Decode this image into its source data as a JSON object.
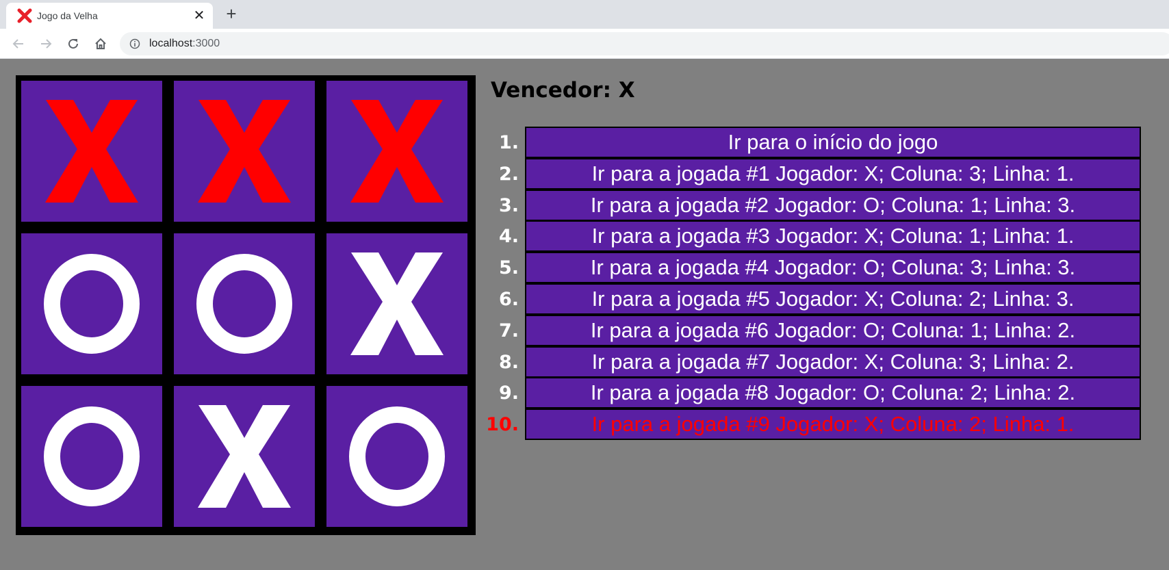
{
  "browser": {
    "tab_title": "Jogo da Velha",
    "url_host": "localhost",
    "url_port": ":3000",
    "favicon": "red-x-icon"
  },
  "game": {
    "status": "Vencedor: X",
    "board": [
      {
        "mark": "X",
        "winning": true
      },
      {
        "mark": "X",
        "winning": true
      },
      {
        "mark": "X",
        "winning": true
      },
      {
        "mark": "O",
        "winning": false
      },
      {
        "mark": "O",
        "winning": false
      },
      {
        "mark": "X",
        "winning": false
      },
      {
        "mark": "O",
        "winning": false
      },
      {
        "mark": "X",
        "winning": false
      },
      {
        "mark": "O",
        "winning": false
      }
    ],
    "moves": [
      {
        "number": "1.",
        "label": "Ir para o início do jogo"
      },
      {
        "number": "2.",
        "label": "Ir para a jogada #1 Jogador: X; Coluna: 3; Linha: 1."
      },
      {
        "number": "3.",
        "label": "Ir para a jogada #2 Jogador: O; Coluna: 1; Linha: 3."
      },
      {
        "number": "4.",
        "label": "Ir para a jogada #3 Jogador: X; Coluna: 1; Linha: 1."
      },
      {
        "number": "5.",
        "label": "Ir para a jogada #4 Jogador: O; Coluna: 3; Linha: 3."
      },
      {
        "number": "6.",
        "label": "Ir para a jogada #5 Jogador: X; Coluna: 2; Linha: 3."
      },
      {
        "number": "7.",
        "label": "Ir para a jogada #6 Jogador: O; Coluna: 1; Linha: 2."
      },
      {
        "number": "8.",
        "label": "Ir para a jogada #7 Jogador: X; Coluna: 3; Linha: 2."
      },
      {
        "number": "9.",
        "label": "Ir para a jogada #8 Jogador: O; Coluna: 2; Linha: 2."
      },
      {
        "number": "10.",
        "label": "Ir para a jogada #9 Jogador: X; Coluna: 2; Linha: 1.",
        "current": true
      }
    ]
  },
  "colors": {
    "page_bg": "#808080",
    "cell_bg": "#5a1fa3",
    "mark": "#ffffff",
    "winning_mark": "#ff0000",
    "current_move": "#ff0000"
  }
}
